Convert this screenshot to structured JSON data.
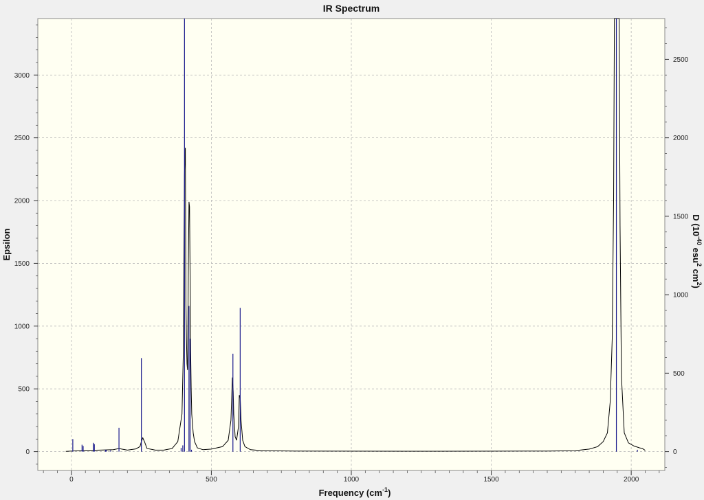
{
  "chart_data": {
    "type": "line",
    "title": "IR Spectrum",
    "xlabel": {
      "main": "Frequency (cm",
      "sup": "-1",
      "end": ")"
    },
    "ylabel_left": "Epsilon",
    "ylabel_right": {
      "p1": "D (10",
      "sup1": "-40",
      "p2": " esu",
      "sup2": "2",
      "p3": " cm",
      "sup3": "2",
      "p4": ")"
    },
    "xlim": [
      -120,
      2120
    ],
    "ylim_left": [
      -150,
      3450
    ],
    "ylim_right": [
      -120,
      2760
    ],
    "x_ticks": [
      0,
      500,
      1000,
      1500,
      2000
    ],
    "y_left_ticks": [
      0,
      500,
      1000,
      1500,
      2000,
      2500,
      3000
    ],
    "y_right_ticks": [
      0,
      500,
      1000,
      1500,
      2000,
      2500
    ],
    "grid": true,
    "series": [
      {
        "kind": "spectrum",
        "axis": "left",
        "color": "#000000",
        "x": [
          -20,
          0,
          50,
          100,
          150,
          170,
          180,
          200,
          230,
          245,
          250,
          255,
          262,
          270,
          300,
          330,
          360,
          380,
          395,
          400,
          404,
          406,
          407,
          409,
          411,
          413,
          415,
          418,
          420,
          422,
          424,
          426,
          428,
          430,
          435,
          440,
          450,
          470,
          500,
          540,
          560,
          570,
          575,
          578,
          580,
          585,
          590,
          597,
          600,
          603,
          606,
          612,
          620,
          640,
          680,
          800,
          1000,
          1200,
          1500,
          1700,
          1800,
          1850,
          1880,
          1900,
          1915,
          1925,
          1932,
          1937,
          1940,
          1943,
          1946,
          1950,
          1954,
          1957,
          1960,
          1965,
          1975,
          1990,
          2010,
          2030,
          2040,
          2050
        ],
        "y": [
          2,
          5,
          10,
          12,
          15,
          25,
          20,
          12,
          22,
          40,
          80,
          110,
          75,
          25,
          12,
          12,
          25,
          80,
          300,
          800,
          2200,
          2400,
          2420,
          1200,
          900,
          700,
          650,
          1500,
          1990,
          1950,
          1400,
          800,
          500,
          300,
          150,
          80,
          30,
          15,
          20,
          40,
          90,
          250,
          590,
          480,
          300,
          120,
          90,
          200,
          450,
          430,
          250,
          90,
          40,
          15,
          8,
          5,
          4,
          3,
          4,
          5,
          8,
          20,
          40,
          80,
          150,
          400,
          900,
          2000,
          3500,
          3500,
          3500,
          3500,
          3500,
          3500,
          1800,
          600,
          150,
          70,
          45,
          30,
          25,
          10
        ]
      },
      {
        "kind": "stick",
        "axis": "left",
        "color": "#1a1a8c",
        "x": [
          5,
          38,
          42,
          78,
          82,
          122,
          125,
          140,
          170,
          250,
          392,
          398,
          404,
          420,
          424,
          429,
          577,
          603,
          1947,
          2022
        ],
        "y": [
          100,
          55,
          45,
          70,
          60,
          15,
          12,
          10,
          190,
          745,
          30,
          50,
          3450,
          1160,
          900,
          15,
          780,
          1145,
          3450,
          15
        ]
      }
    ]
  }
}
